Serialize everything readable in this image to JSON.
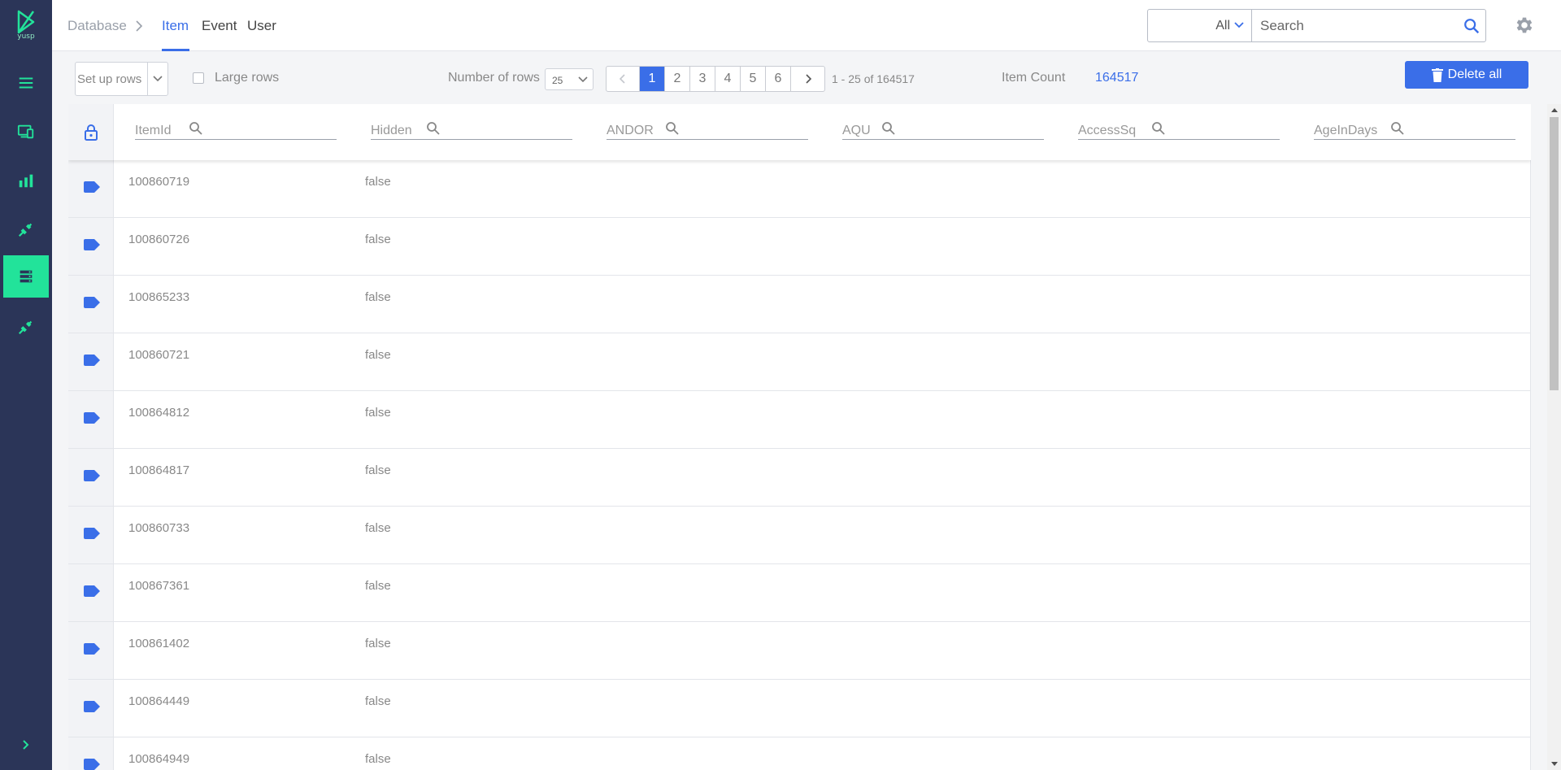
{
  "app": {
    "logo_text": "yusp",
    "brand_color": "#22e39a",
    "sidebar_color": "#2b3558",
    "accent_color": "#3a6ee8"
  },
  "sidebar": {
    "items": [
      {
        "icon": "menu-icon"
      },
      {
        "icon": "devices-icon"
      },
      {
        "icon": "bar-chart-icon"
      },
      {
        "icon": "plug-icon"
      },
      {
        "icon": "database-icon",
        "active": true
      },
      {
        "icon": "plug-icon"
      }
    ],
    "expand_icon": "chevron-right-icon"
  },
  "header": {
    "breadcrumb": "Database",
    "tabs": [
      {
        "label": "Item",
        "active": true
      },
      {
        "label": "Event"
      },
      {
        "label": "User"
      }
    ],
    "search": {
      "filter": "All",
      "placeholder": "Search"
    }
  },
  "toolbar": {
    "setup_rows": "Set up rows",
    "large_rows": "Large rows",
    "number_of_rows_label": "Number of rows",
    "rows_per_page": "25",
    "pages": [
      "1",
      "2",
      "3",
      "4",
      "5",
      "6"
    ],
    "current_page": "1",
    "range": "1 - 25 of 164517",
    "item_count_label": "Item Count",
    "item_count": "164517",
    "delete_all": "Delete all"
  },
  "table": {
    "columns": [
      "ItemId",
      "Hidden",
      "ANDOR",
      "AQU",
      "AccessSq",
      "AgeInDays"
    ],
    "rows": [
      {
        "ItemId": "100860719",
        "Hidden": "false"
      },
      {
        "ItemId": "100860726",
        "Hidden": "false"
      },
      {
        "ItemId": "100865233",
        "Hidden": "false"
      },
      {
        "ItemId": "100860721",
        "Hidden": "false"
      },
      {
        "ItemId": "100864812",
        "Hidden": "false"
      },
      {
        "ItemId": "100864817",
        "Hidden": "false"
      },
      {
        "ItemId": "100860733",
        "Hidden": "false"
      },
      {
        "ItemId": "100867361",
        "Hidden": "false"
      },
      {
        "ItemId": "100861402",
        "Hidden": "false"
      },
      {
        "ItemId": "100864449",
        "Hidden": "false"
      },
      {
        "ItemId": "100864949",
        "Hidden": "false"
      }
    ]
  }
}
